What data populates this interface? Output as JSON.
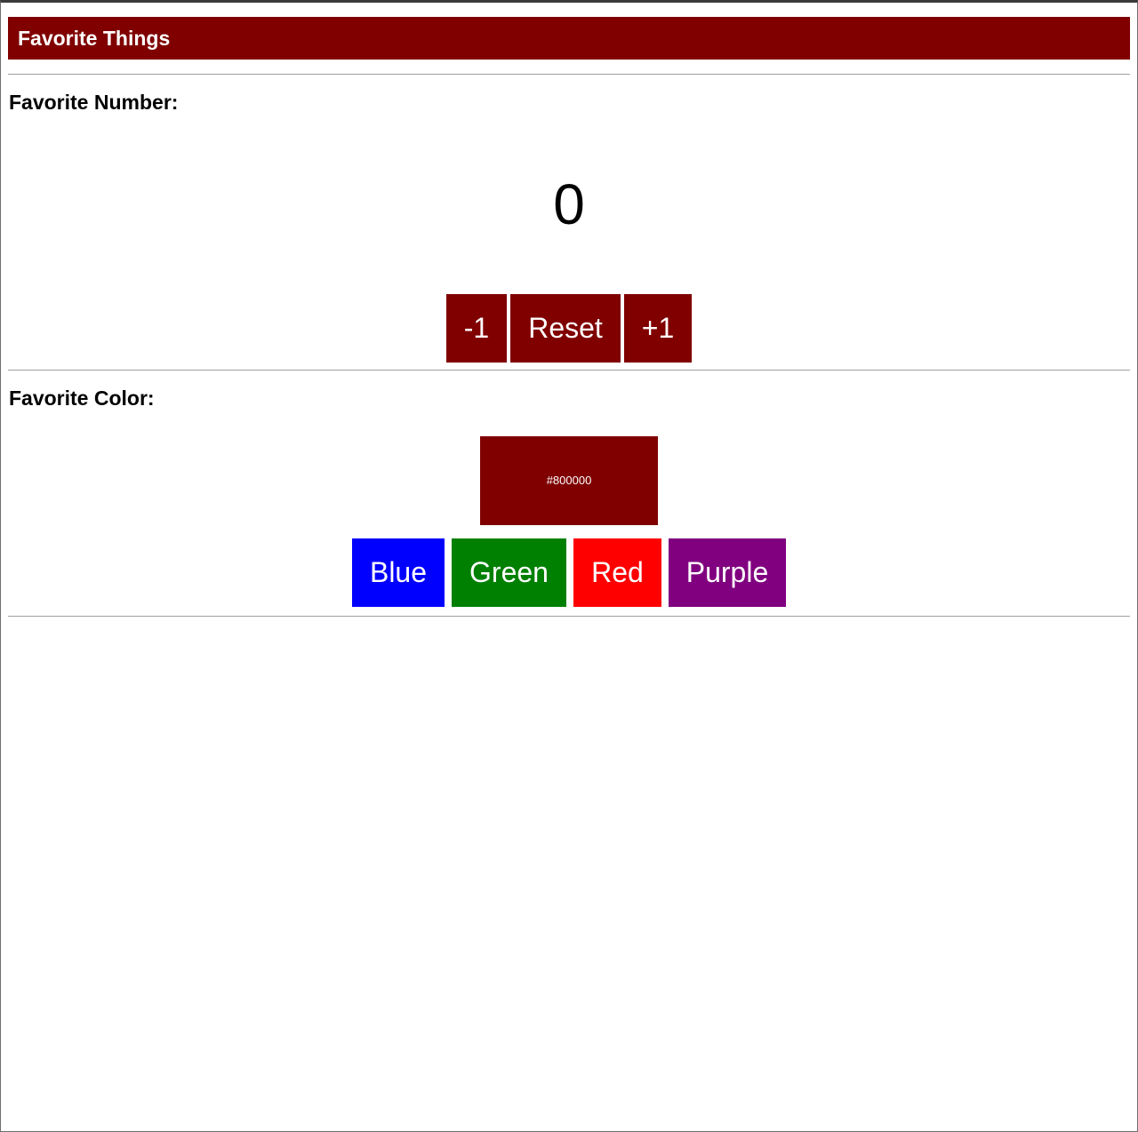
{
  "header": {
    "title": "Favorite Things",
    "color": "#800000"
  },
  "number_section": {
    "title": "Favorite Number:",
    "value": "0",
    "buttons": [
      {
        "label": "-1",
        "color": "#800000"
      },
      {
        "label": "Reset",
        "color": "#800000"
      },
      {
        "label": "+1",
        "color": "#800000"
      }
    ]
  },
  "color_section": {
    "title": "Favorite Color:",
    "swatch_label": "#800000",
    "swatch_color": "#800000",
    "buttons": [
      {
        "label": "Blue",
        "color": "#0000ff"
      },
      {
        "label": "Green",
        "color": "#008000"
      },
      {
        "label": "Red",
        "color": "#ff0000"
      },
      {
        "label": "Purple",
        "color": "#800080"
      }
    ]
  }
}
